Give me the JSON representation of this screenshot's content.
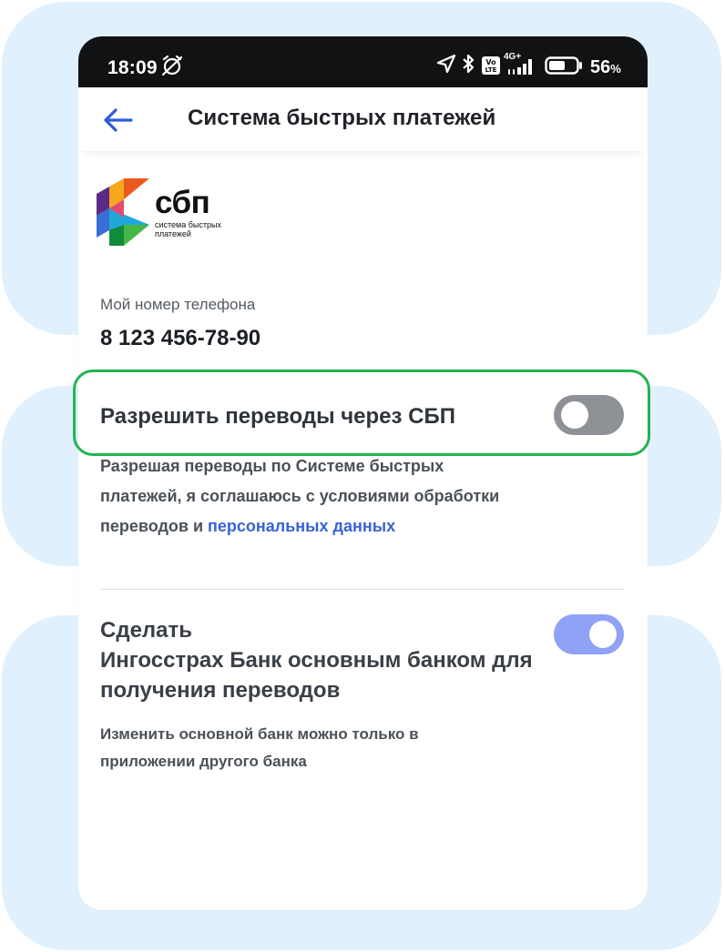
{
  "status_bar": {
    "time": "18:09",
    "battery_percent": "56",
    "battery_unit": "%",
    "network_label": "4G+",
    "volte_label": "Vo LTE"
  },
  "app_bar": {
    "title": "Система быстрых платежей"
  },
  "logo": {
    "name": "сбп",
    "subtitle": "система быстрых платежей"
  },
  "phone": {
    "label": "Мой номер телефона",
    "number": "8 123 456-78-90"
  },
  "sbp_toggle": {
    "label": "Разрешить переводы через СБП",
    "enabled": false
  },
  "consent": {
    "text": "Разрешая переводы по Системе быстрых платежей, я соглашаюсь с условиями обработки переводов и ",
    "link": "персональных данных"
  },
  "default_bank": {
    "title_line1": "Сделать",
    "title_line2": "Ингосстрах Банк основным банком для получения переводов",
    "enabled": true,
    "description": "Изменить основной банк можно только в приложении другого банка"
  },
  "colors": {
    "accent": "#3b62d6",
    "toggle_on": "#8fa2f5",
    "toggle_off": "#8e9297",
    "highlight": "#25b34f",
    "background_panel": "#e1f0fd"
  }
}
